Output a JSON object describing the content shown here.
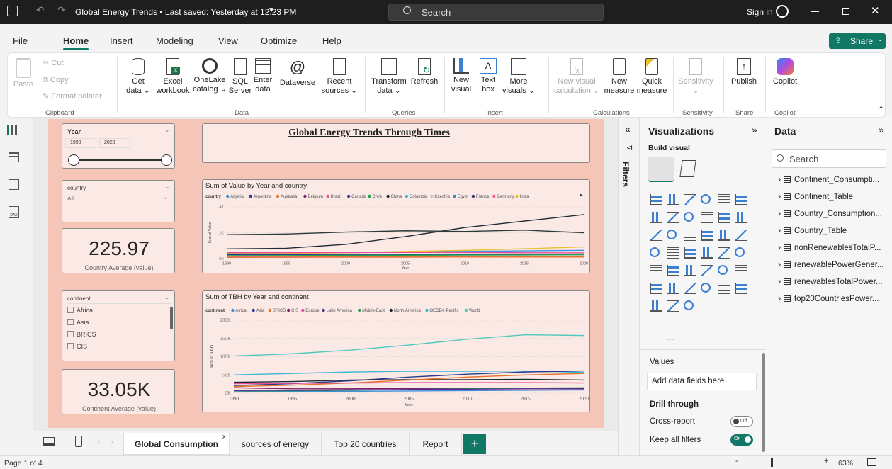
{
  "window": {
    "title": "Global Energy Trends • Last saved: Yesterday at 12:23 PM",
    "search_placeholder": "Search",
    "sign_in": "Sign in"
  },
  "menu": {
    "items": [
      "File",
      "Home",
      "Insert",
      "Modeling",
      "View",
      "Optimize",
      "Help"
    ],
    "share": "Share"
  },
  "ribbon": {
    "clipboard": {
      "paste": "Paste",
      "cut": "Cut",
      "copy": "Copy",
      "format_painter": "Format painter",
      "group": "Clipboard"
    },
    "data": {
      "get_data": [
        "Get",
        "data ⌄"
      ],
      "excel": [
        "Excel",
        "workbook"
      ],
      "onelake": [
        "OneLake",
        "catalog ⌄"
      ],
      "sql": [
        "SQL",
        "Server"
      ],
      "enter": [
        "Enter",
        "data"
      ],
      "dataverse": [
        "Dataverse",
        ""
      ],
      "recent": [
        "Recent",
        "sources ⌄"
      ],
      "group": "Data"
    },
    "queries": {
      "transform": [
        "Transform",
        "data ⌄"
      ],
      "refresh": [
        "Refresh",
        ""
      ],
      "group": "Queries"
    },
    "insert": {
      "new_visual": [
        "New",
        "visual"
      ],
      "text_box": [
        "Text",
        "box"
      ],
      "more_visuals": [
        "More",
        "visuals ⌄"
      ],
      "group": "Insert"
    },
    "calculations": {
      "new_visual_calc": [
        "New visual",
        "calculation ⌄"
      ],
      "new_measure": [
        "New",
        "measure"
      ],
      "quick_measure": [
        "Quick",
        "measure"
      ],
      "group": "Calculations"
    },
    "sensitivity": {
      "label": [
        "Sensitivity",
        "⌄"
      ],
      "group": "Sensitivity"
    },
    "share": {
      "publish": "Publish",
      "group": "Share"
    },
    "copilot": {
      "label": "Copilot",
      "group": "Copilot"
    }
  },
  "report": {
    "title": "Global Energy Trends Through Times",
    "year_slicer": {
      "label": "Year",
      "from": "1990",
      "to": "2020"
    },
    "country_slicer": {
      "label": "country",
      "value": "All"
    },
    "kpi1": {
      "value": "225.97",
      "label": "Country Average (value)"
    },
    "continent_slicer": {
      "label": "continent",
      "options": [
        "Africa",
        "Asia",
        "BRICS",
        "CIS"
      ]
    },
    "kpi2": {
      "value": "33.05K",
      "label": "Continent Average (value)"
    }
  },
  "chart_data": [
    {
      "type": "line",
      "title": "Sum of Value by Year and country",
      "legend_title": "country",
      "legend": [
        "Algeria",
        "Argentina",
        "Australia",
        "Belgium",
        "Brazil",
        "Canada",
        "Chile",
        "China",
        "Colombia",
        "Czechia",
        "Egypt",
        "France",
        "Germany",
        "India"
      ],
      "legend_colors": [
        "#3d8fe0",
        "#2a3a8c",
        "#e8742a",
        "#7a1e6e",
        "#e84a9a",
        "#5b2c8f",
        "#1fa04a",
        "#1e2b35",
        "#3cb6d4",
        "#e0b4c0",
        "#2a8fa8",
        "#2b2b6e",
        "#ef6a8a",
        "#e8c030"
      ],
      "xlabel": "Year",
      "ylabel": "Sum of Value",
      "xlim": [
        1990,
        2020
      ],
      "ylim": [
        0,
        4000
      ],
      "yticks": [
        "0K",
        "2K",
        "4K"
      ],
      "xticks": [
        "1990",
        "1995",
        "2000",
        "2005",
        "2010",
        "2015",
        "2020"
      ],
      "x": [
        1990,
        1995,
        2000,
        2005,
        2010,
        2015,
        2020
      ],
      "series": [
        {
          "color": "#1e2b35",
          "values": [
            750,
            800,
            1100,
            1700,
            2400,
            2900,
            3400
          ]
        },
        {
          "color": "#2b3a3a",
          "values": [
            1850,
            1900,
            2050,
            2150,
            2100,
            2200,
            2000
          ]
        },
        {
          "color": "#3d8fe0",
          "values": [
            400,
            420,
            460,
            520,
            560,
            600,
            640
          ]
        },
        {
          "color": "#e8c030",
          "values": [
            380,
            400,
            450,
            560,
            640,
            760,
            900
          ]
        },
        {
          "color": "#e84a9a",
          "values": [
            460,
            460,
            470,
            480,
            470,
            450,
            440
          ]
        },
        {
          "color": "#2a3a8c",
          "values": [
            300,
            310,
            320,
            330,
            330,
            340,
            340
          ]
        },
        {
          "color": "#1fa04a",
          "values": [
            220,
            230,
            250,
            260,
            270,
            280,
            290
          ]
        },
        {
          "color": "#ef6a8a",
          "values": [
            150,
            160,
            160,
            170,
            170,
            170,
            160
          ]
        },
        {
          "color": "#e8742a",
          "values": [
            90,
            100,
            110,
            110,
            120,
            120,
            120
          ]
        }
      ]
    },
    {
      "type": "line",
      "title": "Sum of TBH by Year and continent",
      "legend_title": "continent",
      "legend": [
        "Africa",
        "Asia",
        "BRICS",
        "CIS",
        "Europe",
        "Latin America",
        "Middle-East",
        "North America",
        "OECD",
        "Pacific",
        "World"
      ],
      "legend_colors": [
        "#3d8fe0",
        "#2a3a8c",
        "#e8742a",
        "#7a1e6e",
        "#e84a9a",
        "#5b2c8f",
        "#1fa04a",
        "#1e2b35",
        "#3cb6d4",
        "#c8b4c8",
        "#4fc8c0"
      ],
      "xlabel": "Year",
      "ylabel": "Sum of TBH",
      "xlim": [
        1990,
        2020
      ],
      "ylim": [
        0,
        200000
      ],
      "yticks": [
        "0K",
        "50K",
        "100K",
        "150K",
        "200K"
      ],
      "xticks": [
        "1990",
        "1995",
        "2000",
        "2005",
        "2010",
        "2015",
        "2020"
      ],
      "x": [
        1990,
        1995,
        2000,
        2005,
        2010,
        2015,
        2020
      ],
      "series": [
        {
          "color": "#4fc8c0",
          "values": [
            102000,
            108000,
            118000,
            132000,
            148000,
            160000,
            158000
          ]
        },
        {
          "color": "#3cb6d4",
          "values": [
            50000,
            54000,
            58000,
            60000,
            60000,
            61000,
            57000
          ]
        },
        {
          "color": "#2a3a8c",
          "values": [
            21000,
            26000,
            34000,
            44000,
            52000,
            58000,
            61000
          ]
        },
        {
          "color": "#1e2b35",
          "values": [
            30000,
            32000,
            36000,
            37000,
            37000,
            38000,
            36000
          ]
        },
        {
          "color": "#e8742a",
          "values": [
            18000,
            22000,
            28000,
            36000,
            44000,
            50000,
            54000
          ]
        },
        {
          "color": "#e84a9a",
          "values": [
            26000,
            27000,
            28000,
            29000,
            29000,
            29000,
            28000
          ]
        },
        {
          "color": "#7a1e6e",
          "values": [
            15000,
            12000,
            12000,
            13000,
            13000,
            14000,
            14000
          ]
        },
        {
          "color": "#1fa04a",
          "values": [
            4000,
            6000,
            8000,
            10000,
            12000,
            14000,
            15000
          ]
        },
        {
          "color": "#3d8fe0",
          "values": [
            3000,
            4000,
            5000,
            6000,
            7000,
            8000,
            9000
          ]
        },
        {
          "color": "#5b2c8f",
          "values": [
            7000,
            8000,
            9000,
            10000,
            11000,
            12000,
            12000
          ]
        }
      ]
    }
  ],
  "pages": {
    "tabs": [
      "Global Consumption",
      "sources of energy",
      "Top 20 countries",
      "Report"
    ],
    "status": "Page 1 of 4",
    "zoom": "63%"
  },
  "filters": {
    "label": "Filters"
  },
  "visualizations": {
    "title": "Visualizations",
    "build_visual": "Build visual",
    "values_label": "Values",
    "values_placeholder": "Add data fields here",
    "drill_through": "Drill through",
    "cross_report": "Cross-report",
    "cross_report_state": "Off",
    "keep_all_filters": "Keep all filters",
    "keep_all_state": "On",
    "icons": [
      "stacked-bar",
      "stacked-column",
      "clustered-bar",
      "clustered-column",
      "100-bar",
      "100-column",
      "line",
      "area",
      "stacked-area",
      "100-area",
      "line-column",
      "ribbon",
      "waterfall",
      "funnel",
      "scatter",
      "pie",
      "donut",
      "treemap",
      "map",
      "filled-map",
      "shape-map",
      "azure-map",
      "gauge",
      "card",
      "multi-row-card",
      "kpi",
      "slicer",
      "table",
      "matrix",
      "r-visual",
      "python-visual",
      "key-influencers",
      "decomposition-tree",
      "qa",
      "narrative",
      "goals",
      "paginated",
      "power-apps",
      "power-automate",
      "more"
    ]
  },
  "data_pane": {
    "title": "Data",
    "search_placeholder": "Search",
    "tables": [
      "Continent_Consumpti...",
      "Continent_Table",
      "Country_Consumption...",
      "Country_Table",
      "nonRenewablesTotalP...",
      "renewablePowerGener...",
      "renewablesTotalPower...",
      "top20CountriesPower..."
    ]
  }
}
